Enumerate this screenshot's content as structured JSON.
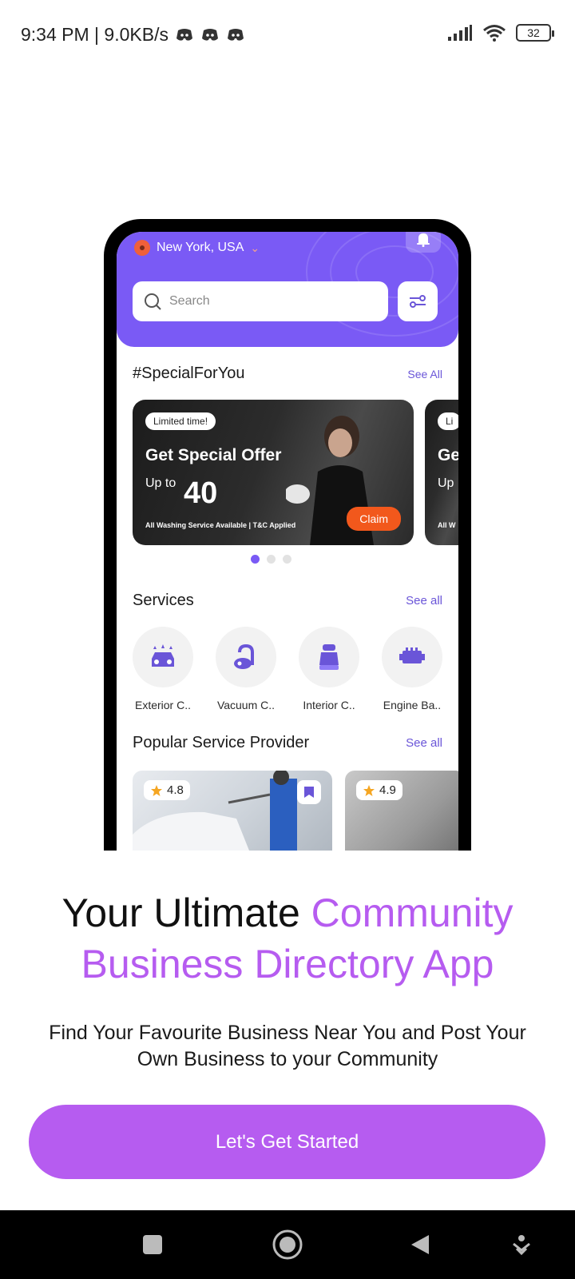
{
  "status_bar": {
    "time_speed": "9:34 PM | 9.0KB/s",
    "battery": "32"
  },
  "mockup": {
    "location": "New York, USA",
    "search_placeholder": "Search",
    "special": {
      "title": "#SpecialForYou",
      "see_all": "See All"
    },
    "promo": {
      "badge": "Limited time!",
      "title": "Get Special Offer",
      "up_to": "Up to",
      "amount": "40",
      "fineprint": "All Washing Service Available | T&C Applied",
      "claim": "Claim",
      "next_badge": "Li",
      "next_title": "Ge",
      "next_up_to": "Up",
      "next_fineprint": "All W"
    },
    "carousel": {
      "count": 3,
      "active": 0
    },
    "services": {
      "title": "Services",
      "see_all": "See all",
      "items": [
        {
          "label": "Exterior C..",
          "icon": "car-wash-icon"
        },
        {
          "label": "Vacuum C..",
          "icon": "vacuum-icon"
        },
        {
          "label": "Interior C..",
          "icon": "car-seat-icon"
        },
        {
          "label": "Engine Ba..",
          "icon": "engine-icon"
        }
      ]
    },
    "providers": {
      "title": "Popular Service Provider",
      "see_all": "See all",
      "items": [
        {
          "rating": "4.8"
        },
        {
          "rating": "4.9"
        }
      ]
    }
  },
  "onboarding": {
    "headline_plain": "Your Ultimate",
    "headline_accent": "Community Business Directory App",
    "subtext": "Find Your Favourite Business Near You and Post Your Own Business to your Community",
    "cta_label": "Let's Get Started"
  },
  "colors": {
    "brand_purple": "#7a5af5",
    "accent_purple": "#b65cf0",
    "claim_orange": "#f2581c"
  }
}
